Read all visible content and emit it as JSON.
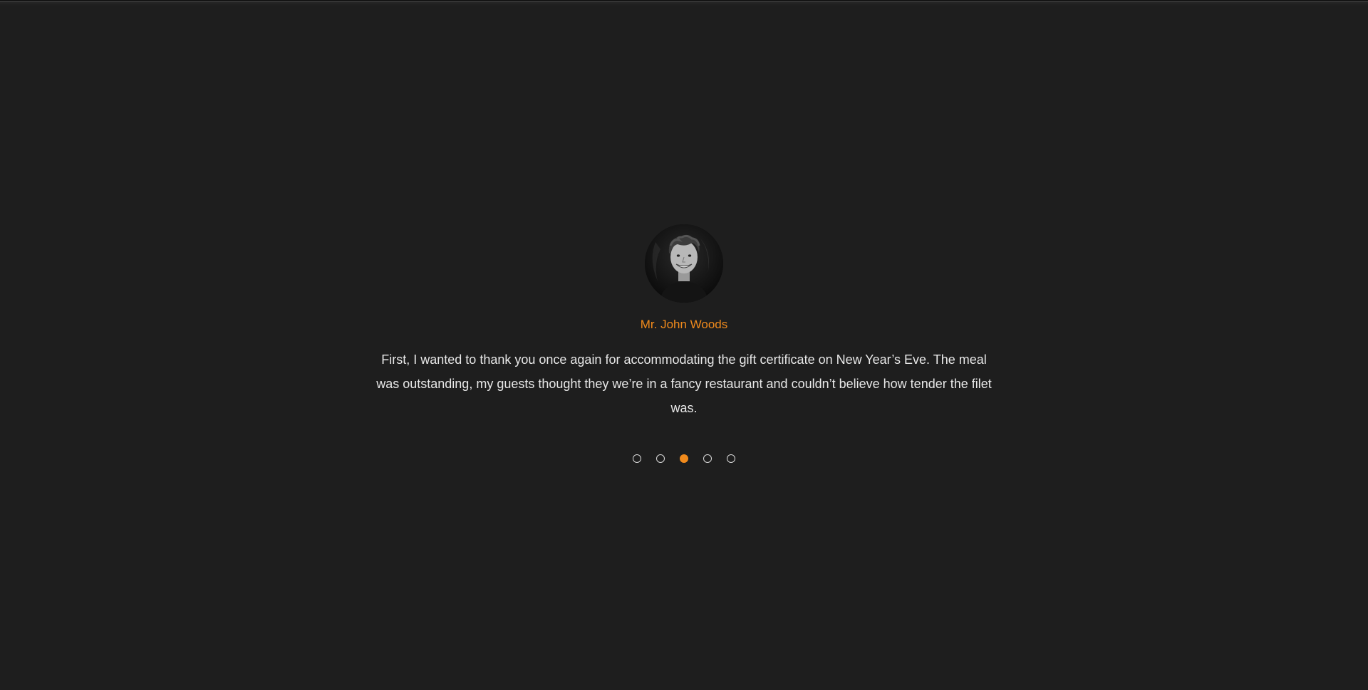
{
  "testimonials": {
    "active_index": 2,
    "current": {
      "name": "Mr. John Woods",
      "quote": "First, I wanted to thank you once again for accommodating the gift certificate on New Year’s Eve. The meal was outstanding, my guests thought they we’re in a fancy restaurant and couldn’t believe how tender the filet was."
    },
    "slide_count": 5
  },
  "colors": {
    "background": "#1e1e1e",
    "accent": "#f08a1c",
    "text": "#e8e8e8",
    "dot_outline": "#d9d9d9"
  }
}
